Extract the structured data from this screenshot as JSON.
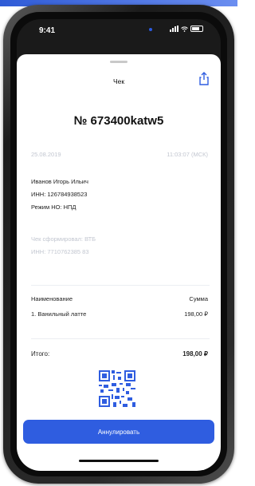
{
  "status_bar": {
    "time": "9:41"
  },
  "sheet": {
    "title": "Чек",
    "share_icon": "share-icon"
  },
  "receipt": {
    "number": "№ 673400katw5",
    "date": "25.08.2019",
    "time": "11:03:07 (МСК)"
  },
  "seller": {
    "name": "Иванов Игорь Ильич",
    "inn": "ИНН: 126784938523",
    "regime": "Режим НО: НПД"
  },
  "issuer": {
    "line1": "Чек сформировал: ВТБ",
    "inn": "ИНН: 7710762385 83"
  },
  "items": {
    "header_name": "Наименование",
    "header_sum": "Сумма",
    "rows": [
      {
        "name": "1. Ванильный латте",
        "sum": "198,00 ₽"
      }
    ]
  },
  "total": {
    "label": "Итого:",
    "value": "198,00 ₽"
  },
  "actions": {
    "cancel_label": "Аннулировать"
  },
  "colors": {
    "accent": "#2f5de0",
    "muted_text": "#c2c6d0"
  }
}
